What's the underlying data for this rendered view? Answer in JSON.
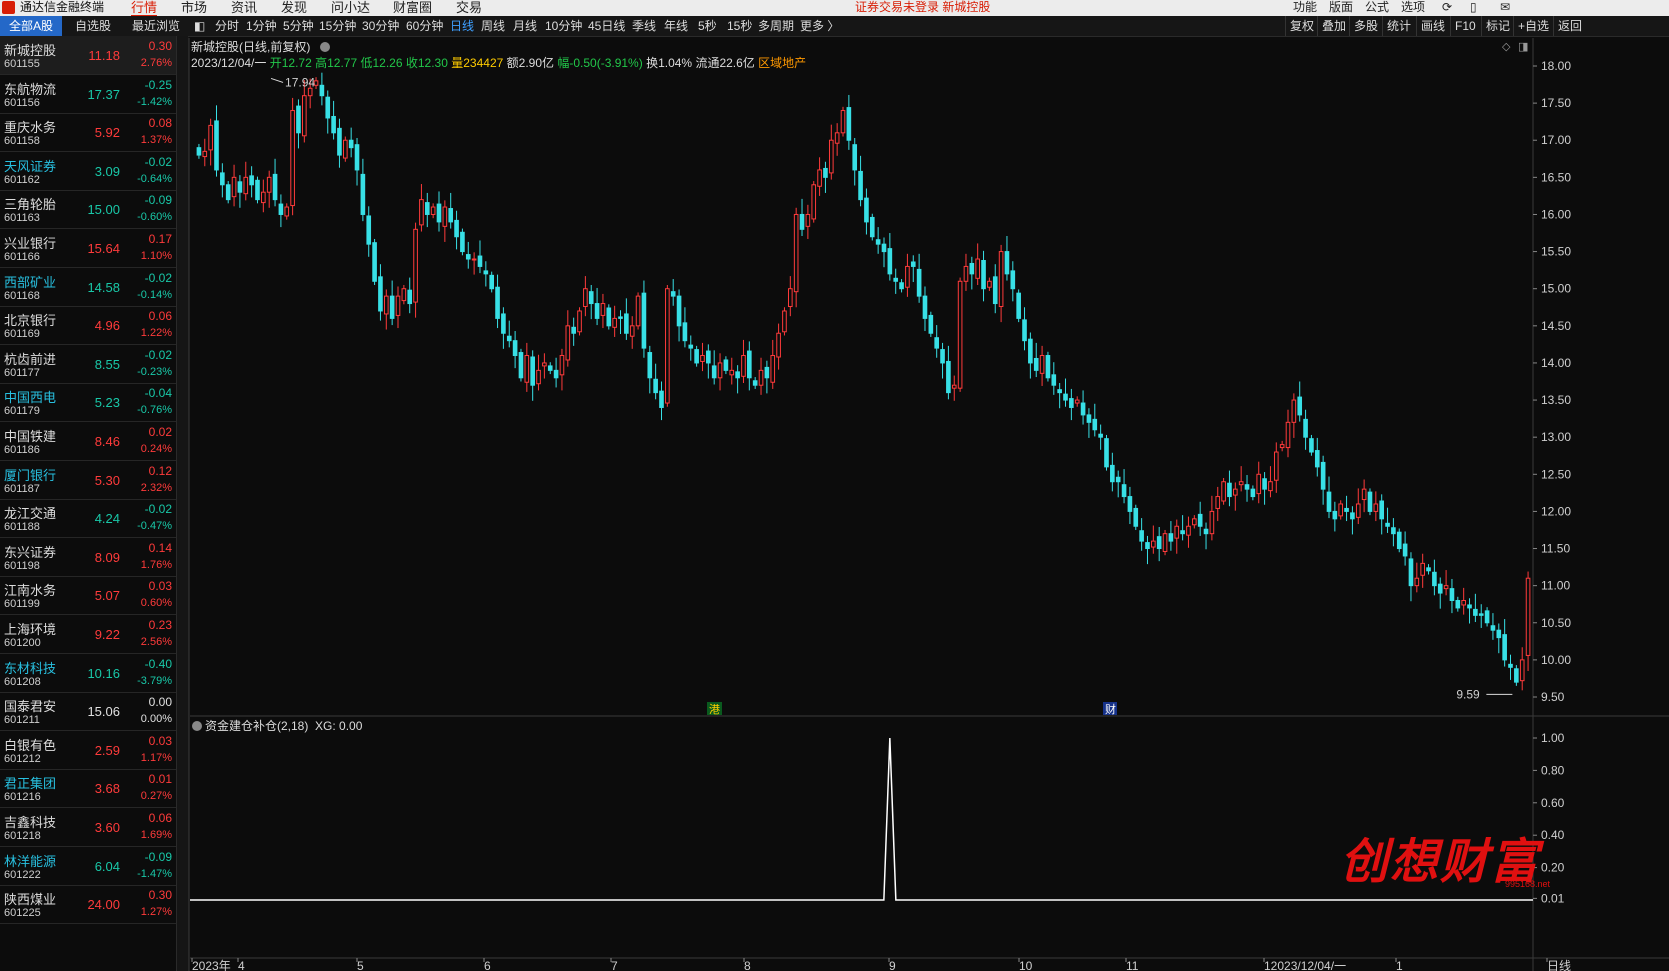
{
  "app": {
    "title": "通达信金融终端",
    "menus": [
      "行情",
      "市场",
      "资讯",
      "发现",
      "问小达",
      "财富圈",
      "交易"
    ],
    "active_menu": "行情",
    "notice": "证券交易未登录  新城控股",
    "right_menus": [
      "功能",
      "版面",
      "公式",
      "选项"
    ]
  },
  "list_tabs": [
    "全部A股",
    "自选股",
    "最近浏览"
  ],
  "stocks": [
    {
      "name": "新城控股",
      "code": "601155",
      "price": "11.18",
      "chg": "0.30",
      "pct": "2.76%",
      "dir": "up",
      "hl": false
    },
    {
      "name": "东航物流",
      "code": "601156",
      "price": "17.37",
      "chg": "-0.25",
      "pct": "-1.42%",
      "dir": "dn",
      "hl": false
    },
    {
      "name": "重庆水务",
      "code": "601158",
      "price": "5.92",
      "chg": "0.08",
      "pct": "1.37%",
      "dir": "up",
      "hl": false
    },
    {
      "name": "天风证券",
      "code": "601162",
      "price": "3.09",
      "chg": "-0.02",
      "pct": "-0.64%",
      "dir": "dn",
      "hl": true
    },
    {
      "name": "三角轮胎",
      "code": "601163",
      "price": "15.00",
      "chg": "-0.09",
      "pct": "-0.60%",
      "dir": "dn",
      "hl": false
    },
    {
      "name": "兴业银行",
      "code": "601166",
      "price": "15.64",
      "chg": "0.17",
      "pct": "1.10%",
      "dir": "up",
      "hl": false
    },
    {
      "name": "西部矿业",
      "code": "601168",
      "price": "14.58",
      "chg": "-0.02",
      "pct": "-0.14%",
      "dir": "dn",
      "hl": true
    },
    {
      "name": "北京银行",
      "code": "601169",
      "price": "4.96",
      "chg": "0.06",
      "pct": "1.22%",
      "dir": "up",
      "hl": false
    },
    {
      "name": "杭齿前进",
      "code": "601177",
      "price": "8.55",
      "chg": "-0.02",
      "pct": "-0.23%",
      "dir": "dn",
      "hl": false
    },
    {
      "name": "中国西电",
      "code": "601179",
      "price": "5.23",
      "chg": "-0.04",
      "pct": "-0.76%",
      "dir": "dn",
      "hl": true
    },
    {
      "name": "中国铁建",
      "code": "601186",
      "price": "8.46",
      "chg": "0.02",
      "pct": "0.24%",
      "dir": "up",
      "hl": false
    },
    {
      "name": "厦门银行",
      "code": "601187",
      "price": "5.30",
      "chg": "0.12",
      "pct": "2.32%",
      "dir": "up",
      "hl": true
    },
    {
      "name": "龙江交通",
      "code": "601188",
      "price": "4.24",
      "chg": "-0.02",
      "pct": "-0.47%",
      "dir": "dn",
      "hl": false
    },
    {
      "name": "东兴证券",
      "code": "601198",
      "price": "8.09",
      "chg": "0.14",
      "pct": "1.76%",
      "dir": "up",
      "hl": false
    },
    {
      "name": "江南水务",
      "code": "601199",
      "price": "5.07",
      "chg": "0.03",
      "pct": "0.60%",
      "dir": "up",
      "hl": false
    },
    {
      "name": "上海环境",
      "code": "601200",
      "price": "9.22",
      "chg": "0.23",
      "pct": "2.56%",
      "dir": "up",
      "hl": false
    },
    {
      "name": "东材科技",
      "code": "601208",
      "price": "10.16",
      "chg": "-0.40",
      "pct": "-3.79%",
      "dir": "dn",
      "hl": true
    },
    {
      "name": "国泰君安",
      "code": "601211",
      "price": "15.06",
      "chg": "0.00",
      "pct": "0.00%",
      "dir": "fl",
      "hl": false
    },
    {
      "name": "白银有色",
      "code": "601212",
      "price": "2.59",
      "chg": "0.03",
      "pct": "1.17%",
      "dir": "up",
      "hl": false
    },
    {
      "name": "君正集团",
      "code": "601216",
      "price": "3.68",
      "chg": "0.01",
      "pct": "0.27%",
      "dir": "up",
      "hl": true
    },
    {
      "name": "吉鑫科技",
      "code": "601218",
      "price": "3.60",
      "chg": "0.06",
      "pct": "1.69%",
      "dir": "up",
      "hl": false
    },
    {
      "name": "林洋能源",
      "code": "601222",
      "price": "6.04",
      "chg": "-0.09",
      "pct": "-1.47%",
      "dir": "dn",
      "hl": true
    },
    {
      "name": "陕西煤业",
      "code": "601225",
      "price": "24.00",
      "chg": "0.30",
      "pct": "1.27%",
      "dir": "up",
      "hl": false
    }
  ],
  "toolbar": {
    "periods": [
      "分时",
      "1分钟",
      "5分钟",
      "15分钟",
      "30分钟",
      "60分钟",
      "日线",
      "周线",
      "月线",
      "10分钟",
      "45日线",
      "季线",
      "年线",
      "5秒",
      "15秒",
      "多周期",
      "更多 〉"
    ],
    "active": "日线",
    "right": [
      "复权",
      "叠加",
      "多股",
      "统计",
      "画线",
      "F10",
      "标记",
      "+自选",
      "返回"
    ]
  },
  "chart_header": {
    "title": "新城控股(日线,前复权)",
    "date": "2023/12/04/一",
    "open": "开12.72",
    "high": "高12.77",
    "low": "低12.26",
    "close": "收12.30",
    "volume": "量234427",
    "amount": "额2.90亿",
    "range": "幅-0.50(-3.91%)",
    "turnover": "换1.04%",
    "float": "流通22.6亿",
    "sector": "区域地产"
  },
  "markers": {
    "max_label": "17.94",
    "min_label": "9.59",
    "hk_tag": "港",
    "fin_tag": "财"
  },
  "indicator": {
    "name": "资金建仓补仓(2,18)",
    "xg": "XG: 0.00",
    "ticks": [
      "1.00",
      "0.80",
      "0.60",
      "0.40",
      "0.20",
      "0.01"
    ]
  },
  "watermark": {
    "text": "创想财富",
    "url": "995168.net"
  },
  "colors": {
    "up": "#ff3b3b",
    "down": "#38e0e6",
    "bg": "#0c0c0c",
    "accent": "#2468c8"
  },
  "chart_data": {
    "type": "candlestick",
    "price_axis_ticks": [
      "18.00",
      "17.50",
      "17.00",
      "16.50",
      "16.00",
      "15.50",
      "15.00",
      "14.50",
      "14.00",
      "13.50",
      "13.00",
      "12.50",
      "12.00",
      "11.50",
      "11.00",
      "10.50",
      "10.00",
      "9.50"
    ],
    "date_axis_ticks": [
      "2023年",
      "4",
      "5",
      "6",
      "7",
      "8",
      "9",
      "10",
      "11",
      "12023/12/04/一",
      "1",
      "日线"
    ],
    "ylim": [
      9.5,
      18.0
    ],
    "max_price": 17.94,
    "min_price": 9.59,
    "closes": [
      16.8,
      16.85,
      17.2,
      16.6,
      16.4,
      16.2,
      16.5,
      16.3,
      16.5,
      16.4,
      16.2,
      16.3,
      16.5,
      16.2,
      16.0,
      16.1,
      17.4,
      17.1,
      17.6,
      17.7,
      17.8,
      17.6,
      17.3,
      17.1,
      16.8,
      17.0,
      16.9,
      16.6,
      16.0,
      15.6,
      15.1,
      14.7,
      14.9,
      14.6,
      14.9,
      15.0,
      14.8,
      15.8,
      16.2,
      16.0,
      16.1,
      15.9,
      16.1,
      15.9,
      15.7,
      15.5,
      15.4,
      15.4,
      15.3,
      15.2,
      15.0,
      14.6,
      14.4,
      14.3,
      14.1,
      13.8,
      14.1,
      13.7,
      13.9,
      14.0,
      13.9,
      13.8,
      14.1,
      14.5,
      14.4,
      14.7,
      15.0,
      14.8,
      14.6,
      14.8,
      14.5,
      14.6,
      14.6,
      14.4,
      14.5,
      14.9,
      14.2,
      13.8,
      13.6,
      13.4,
      15.0,
      14.9,
      14.5,
      14.3,
      14.2,
      14.0,
      14.1,
      14.0,
      13.8,
      14.0,
      13.9,
      13.9,
      13.8,
      14.1,
      13.8,
      13.7,
      13.9,
      13.8,
      14.1,
      14.4,
      14.7,
      15.0,
      16.0,
      15.8,
      16.0,
      16.4,
      16.6,
      16.5,
      17.0,
      17.1,
      17.4,
      17.0,
      16.6,
      16.2,
      15.9,
      15.7,
      15.6,
      15.5,
      15.2,
      15.1,
      15.0,
      15.3,
      15.3,
      14.9,
      14.6,
      14.4,
      14.2,
      14.0,
      13.6,
      13.7,
      15.1,
      15.3,
      15.2,
      15.4,
      15.0,
      15.1,
      14.8,
      15.5,
      15.2,
      15.0,
      14.6,
      14.3,
      14.0,
      13.9,
      14.1,
      13.8,
      13.7,
      13.6,
      13.5,
      13.4,
      13.5,
      13.3,
      13.2,
      13.1,
      13.0,
      12.6,
      12.4,
      12.4,
      12.2,
      12.0,
      11.8,
      11.6,
      11.5,
      11.6,
      11.5,
      11.7,
      11.6,
      11.8,
      11.7,
      11.8,
      11.9,
      11.8,
      11.7,
      12.0,
      12.2,
      12.4,
      12.2,
      12.3,
      12.4,
      12.3,
      12.2,
      12.5,
      12.3,
      12.4,
      12.8,
      12.9,
      13.2,
      13.5,
      13.3,
      13.0,
      12.8,
      12.6,
      12.3,
      12.0,
      11.9,
      12.1,
      12.0,
      11.9,
      12.1,
      12.3,
      12.0,
      12.1,
      11.9,
      11.8,
      11.7,
      11.5,
      11.4,
      11.0,
      11.1,
      11.3,
      11.2,
      11.0,
      10.9,
      11.0,
      10.8,
      10.7,
      10.8,
      10.7,
      10.6,
      10.6,
      10.5,
      10.4,
      10.3,
      10.0,
      9.9,
      9.7,
      10.0,
      11.1
    ],
    "indicator_values": {
      "type": "spike",
      "peak_index": 118,
      "peak": 1.0,
      "baseline": 0.0
    }
  }
}
